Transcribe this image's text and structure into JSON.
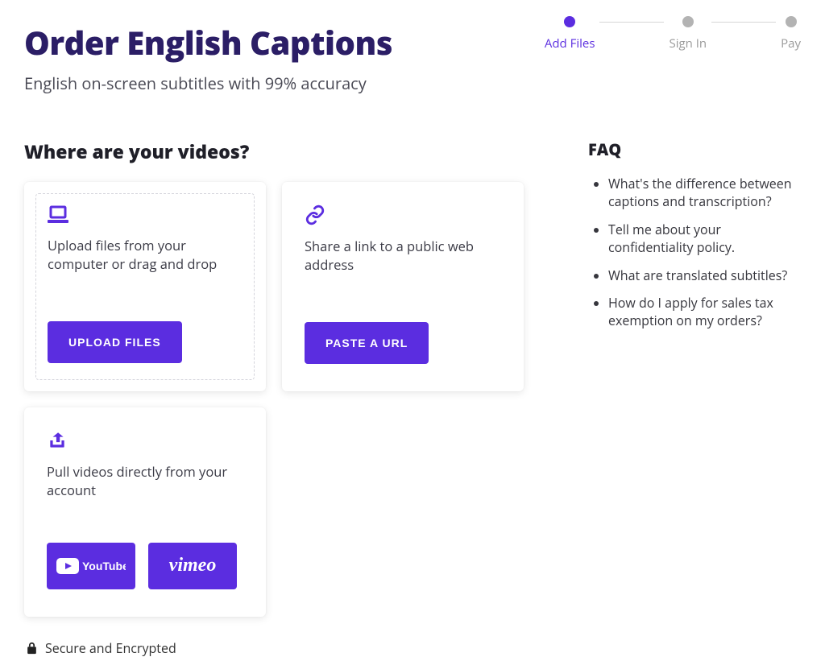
{
  "header": {
    "title": "Order English Captions",
    "subtitle": "English on-screen subtitles with 99% accuracy"
  },
  "stepper": {
    "steps": [
      {
        "label": "Add Files",
        "active": true
      },
      {
        "label": "Sign In",
        "active": false
      },
      {
        "label": "Pay",
        "active": false
      }
    ]
  },
  "section_title": "Where are your videos?",
  "cards": {
    "upload": {
      "desc": "Upload files from your computer or drag and drop",
      "button": "UPLOAD FILES"
    },
    "url": {
      "desc": "Share a link to a public web address",
      "button": "PASTE A URL"
    },
    "accounts": {
      "desc": "Pull videos directly from your account",
      "youtube_label": "YouTube",
      "vimeo_label": "vimeo"
    }
  },
  "faq": {
    "title": "FAQ",
    "items": [
      "What's the difference between captions and transcription?",
      "Tell me about your confidentiality policy.",
      "What are translated subtitles?",
      "How do I apply for sales tax exemption on my orders?"
    ]
  },
  "secure_label": "Secure and Encrypted",
  "colors": {
    "accent": "#5b2de0"
  }
}
